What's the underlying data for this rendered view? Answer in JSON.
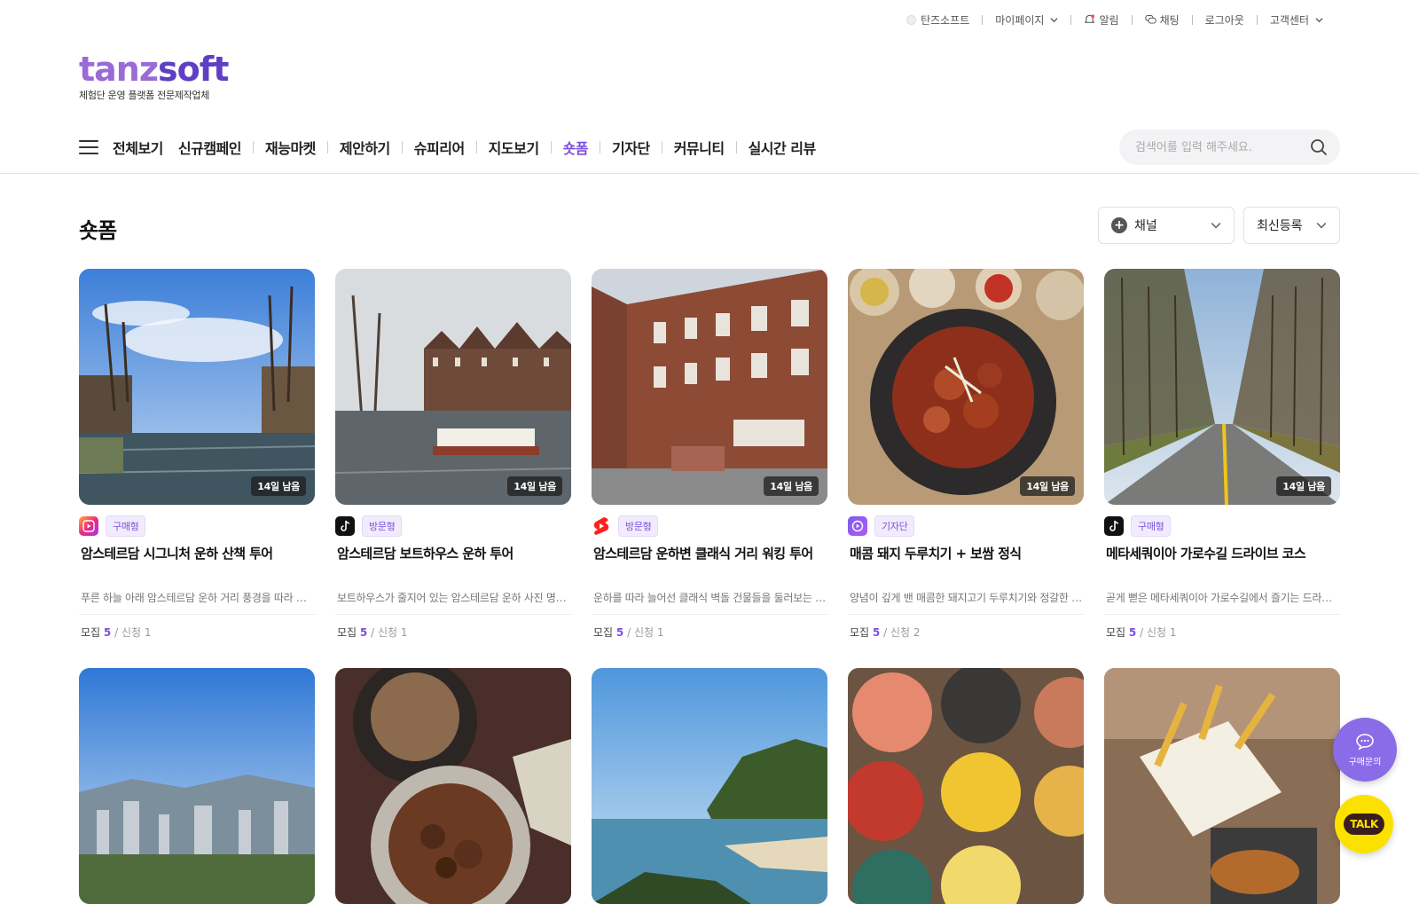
{
  "topbar": {
    "items": [
      {
        "label": "탄즈소프트",
        "icon": "dot-icon"
      },
      {
        "label": "마이페이지",
        "icon": "chevron-down-icon"
      },
      {
        "label": "알림",
        "icon": "bell-icon"
      },
      {
        "label": "채팅",
        "icon": "chat-icon"
      },
      {
        "label": "로그아웃"
      },
      {
        "label": "고객센터",
        "icon": "chevron-down-icon"
      }
    ]
  },
  "logo": {
    "word_a": "tanz",
    "word_b": "soft",
    "tagline": "체험단 운영 플랫폼 전문제작업체"
  },
  "nav": {
    "items": [
      "전체보기",
      "신규캠페인",
      "재능마켓",
      "제안하기",
      "슈피리어",
      "지도보기",
      "숏폼",
      "기자단",
      "커뮤니티",
      "실시간 리뷰"
    ],
    "active_index": 6
  },
  "search": {
    "placeholder": "검색어를 입력 해주세요."
  },
  "page": {
    "title": "숏폼"
  },
  "filters": {
    "channel": "채널",
    "sort": "최신등록"
  },
  "cards": [
    {
      "days": "14일 남음",
      "channel": "instagram-reels-icon",
      "type": "구매형",
      "title": "암스테르담 시그니처 운하 산책 투어",
      "desc": "푸른 하늘 아래 암스테르담 운하 거리 풍경을 따라 걷는 시그니처 산책 코스",
      "recruit_label": "모집",
      "recruit": "5",
      "apply": "신청 1"
    },
    {
      "days": "14일 남음",
      "channel": "tiktok-icon",
      "type": "방문형",
      "title": "암스테르담 보트하우스 운하 투어",
      "desc": "보트하우스가 줄지어 있는 암스테르담 운하 사진 명소를 따라가는 투어",
      "recruit_label": "모집",
      "recruit": "5",
      "apply": "신청 1"
    },
    {
      "days": "14일 남음",
      "channel": "youtube-shorts-icon",
      "type": "방문형",
      "title": "암스테르담 운하변 클래식 거리 워킹 투어",
      "desc": "운하를 따라 늘어선 클래식 벽돌 건물들을 둘러보는 워킹 투어",
      "recruit_label": "모집",
      "recruit": "5",
      "apply": "신청 1"
    },
    {
      "days": "14일 남음",
      "channel": "naver-clip-icon",
      "type": "기자단",
      "title": "매콤 돼지 두루치기 + 보쌈 정식",
      "desc": "양념이 깊게 밴 매콤한 돼지고기 두루치기와 정갈한 반찬 구성",
      "recruit_label": "모집",
      "recruit": "5",
      "apply": "신청 2"
    },
    {
      "days": "14일 남음",
      "channel": "tiktok-icon",
      "type": "구매형",
      "title": "메타세쿼이아 가로수길 드라이브 코스",
      "desc": "곧게 뻗은 메타세쿼이아 가로수길에서 즐기는 드라이브 코스",
      "recruit_label": "모집",
      "recruit": "5",
      "apply": "신청 1"
    }
  ],
  "floating": {
    "inquiry_label": "구매문의",
    "talk_label": "TALK"
  },
  "colors": {
    "accent": "#7a4fe0",
    "kakao": "#fae100"
  }
}
